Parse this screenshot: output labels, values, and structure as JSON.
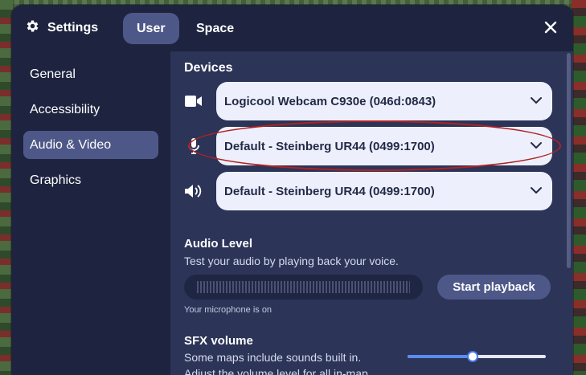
{
  "header": {
    "title": "Settings",
    "tabs": [
      {
        "label": "User",
        "active": true
      },
      {
        "label": "Space",
        "active": false
      }
    ]
  },
  "sidebar": {
    "items": [
      {
        "label": "General",
        "active": false
      },
      {
        "label": "Accessibility",
        "active": false
      },
      {
        "label": "Audio & Video",
        "active": true
      },
      {
        "label": "Graphics",
        "active": false
      }
    ]
  },
  "devices": {
    "title": "Devices",
    "camera": {
      "icon": "video-camera-icon",
      "selected": "Logicool Webcam C930e (046d:0843)"
    },
    "microphone": {
      "icon": "microphone-icon",
      "selected": "Default - Steinberg UR44 (0499:1700)"
    },
    "speaker": {
      "icon": "speaker-icon",
      "selected": "Default - Steinberg UR44 (0499:1700)"
    }
  },
  "audio_level": {
    "title": "Audio Level",
    "description": "Test your audio by playing back your voice.",
    "playback_label": "Start playback",
    "status": "Your microphone is on"
  },
  "sfx": {
    "title": "SFX volume",
    "description_line1": "Some maps include sounds built in.",
    "description_line2": "Adjust the volume level for all in-map",
    "volume": 0.47
  },
  "colors": {
    "panel": "#2c3458",
    "sidebar": "#1e2440",
    "active_item": "#4e5888",
    "select_bg": "#edf0fc",
    "slider_fill": "#5a8cf0",
    "annotation": "#b22222"
  }
}
